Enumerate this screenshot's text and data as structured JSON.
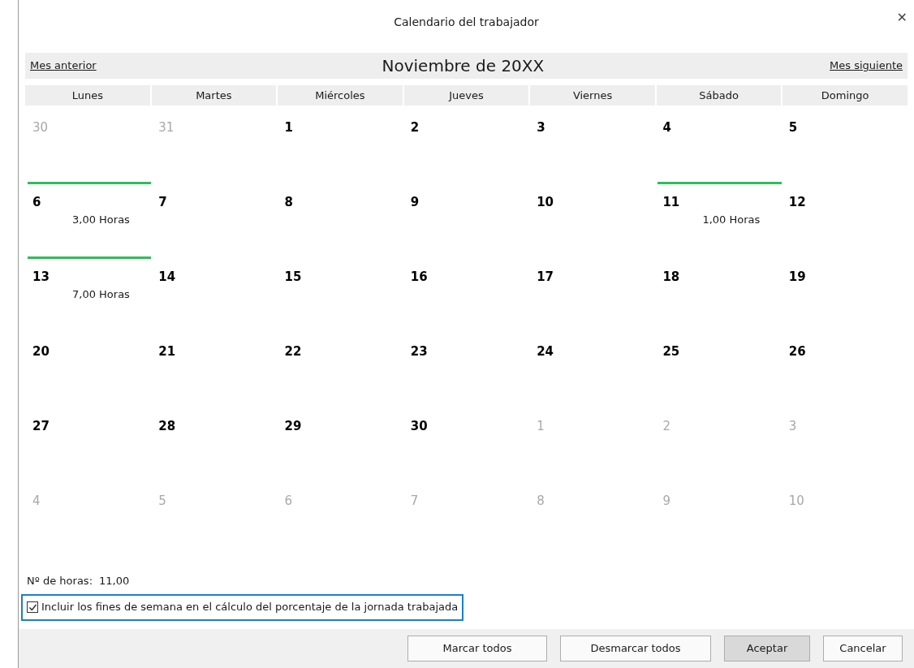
{
  "window": {
    "title": "Calendario del trabajador",
    "close": "✕"
  },
  "nav": {
    "previous": "Mes anterior",
    "month": "Noviembre de 20XX",
    "next": "Mes siguiente"
  },
  "weekdays": [
    "Lunes",
    "Martes",
    "Miércoles",
    "Jueves",
    "Viernes",
    "Sábado",
    "Domingo"
  ],
  "days": [
    {
      "day": "30",
      "other_month": true,
      "marked": false
    },
    {
      "day": "31",
      "other_month": true,
      "marked": false
    },
    {
      "day": "1",
      "other_month": false,
      "marked": false
    },
    {
      "day": "2",
      "other_month": false,
      "marked": false
    },
    {
      "day": "3",
      "other_month": false,
      "marked": false
    },
    {
      "day": "4",
      "other_month": false,
      "marked": false
    },
    {
      "day": "5",
      "other_month": false,
      "marked": false
    },
    {
      "day": "6",
      "other_month": false,
      "marked": true,
      "hours": "3,00 Horas"
    },
    {
      "day": "7",
      "other_month": false,
      "marked": false
    },
    {
      "day": "8",
      "other_month": false,
      "marked": false
    },
    {
      "day": "9",
      "other_month": false,
      "marked": false
    },
    {
      "day": "10",
      "other_month": false,
      "marked": false
    },
    {
      "day": "11",
      "other_month": false,
      "marked": true,
      "hours": "1,00 Horas"
    },
    {
      "day": "12",
      "other_month": false,
      "marked": false
    },
    {
      "day": "13",
      "other_month": false,
      "marked": true,
      "hours": "7,00 Horas"
    },
    {
      "day": "14",
      "other_month": false,
      "marked": false
    },
    {
      "day": "15",
      "other_month": false,
      "marked": false
    },
    {
      "day": "16",
      "other_month": false,
      "marked": false
    },
    {
      "day": "17",
      "other_month": false,
      "marked": false
    },
    {
      "day": "18",
      "other_month": false,
      "marked": false
    },
    {
      "day": "19",
      "other_month": false,
      "marked": false
    },
    {
      "day": "20",
      "other_month": false,
      "marked": false
    },
    {
      "day": "21",
      "other_month": false,
      "marked": false
    },
    {
      "day": "22",
      "other_month": false,
      "marked": false
    },
    {
      "day": "23",
      "other_month": false,
      "marked": false
    },
    {
      "day": "24",
      "other_month": false,
      "marked": false
    },
    {
      "day": "25",
      "other_month": false,
      "marked": false
    },
    {
      "day": "26",
      "other_month": false,
      "marked": false
    },
    {
      "day": "27",
      "other_month": false,
      "marked": false
    },
    {
      "day": "28",
      "other_month": false,
      "marked": false
    },
    {
      "day": "29",
      "other_month": false,
      "marked": false
    },
    {
      "day": "30",
      "other_month": false,
      "marked": false
    },
    {
      "day": "1",
      "other_month": true,
      "marked": false
    },
    {
      "day": "2",
      "other_month": true,
      "marked": false
    },
    {
      "day": "3",
      "other_month": true,
      "marked": false
    },
    {
      "day": "4",
      "other_month": true,
      "marked": false
    },
    {
      "day": "5",
      "other_month": true,
      "marked": false
    },
    {
      "day": "6",
      "other_month": true,
      "marked": false
    },
    {
      "day": "7",
      "other_month": true,
      "marked": false
    },
    {
      "day": "8",
      "other_month": true,
      "marked": false
    },
    {
      "day": "9",
      "other_month": true,
      "marked": false
    },
    {
      "day": "10",
      "other_month": true,
      "marked": false
    }
  ],
  "total": {
    "label": "Nº de horas:",
    "value": "11,00"
  },
  "weekend_option": {
    "label": "Incluir los fines de semana en el cálculo del porcentaje de la jornada trabajada",
    "checked": true
  },
  "buttons": [
    {
      "label": "Marcar todos",
      "default": false
    },
    {
      "label": "Desmarcar todos",
      "default": false
    },
    {
      "label": "Aceptar",
      "default": true
    },
    {
      "label": "Cancelar",
      "default": false
    }
  ]
}
